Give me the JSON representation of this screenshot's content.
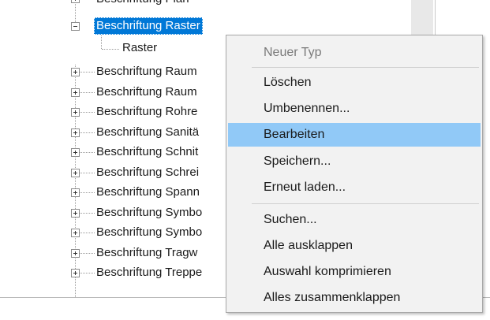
{
  "tree": {
    "partial_top_label": "Beschriftung Plan",
    "selected_label": "Beschriftung Raster",
    "child_label": "Raster",
    "items": [
      "Beschriftung Raum",
      "Beschriftung Raum",
      "Beschriftung Rohre",
      "Beschriftung Sanitä",
      "Beschriftung Schnit",
      "Beschriftung Schrei",
      "Beschriftung Spann",
      "Beschriftung Symbo",
      "Beschriftung Symbo",
      "Beschriftung Tragw",
      "Beschriftung Treppe"
    ]
  },
  "context_menu": {
    "items": [
      "Neuer Typ",
      "Löschen",
      "Umbenennen...",
      "Bearbeiten",
      "Speichern...",
      "Erneut laden...",
      "Suchen...",
      "Alle ausklappen",
      "Auswahl komprimieren",
      "Alles zusammenklappen"
    ],
    "disabled_item": "Neuer Typ",
    "highlighted_item": "Bearbeiten"
  },
  "colors": {
    "selection": "#0078d7",
    "menu_highlight": "#91c9f7",
    "menu_background": "#f2f2f2"
  }
}
